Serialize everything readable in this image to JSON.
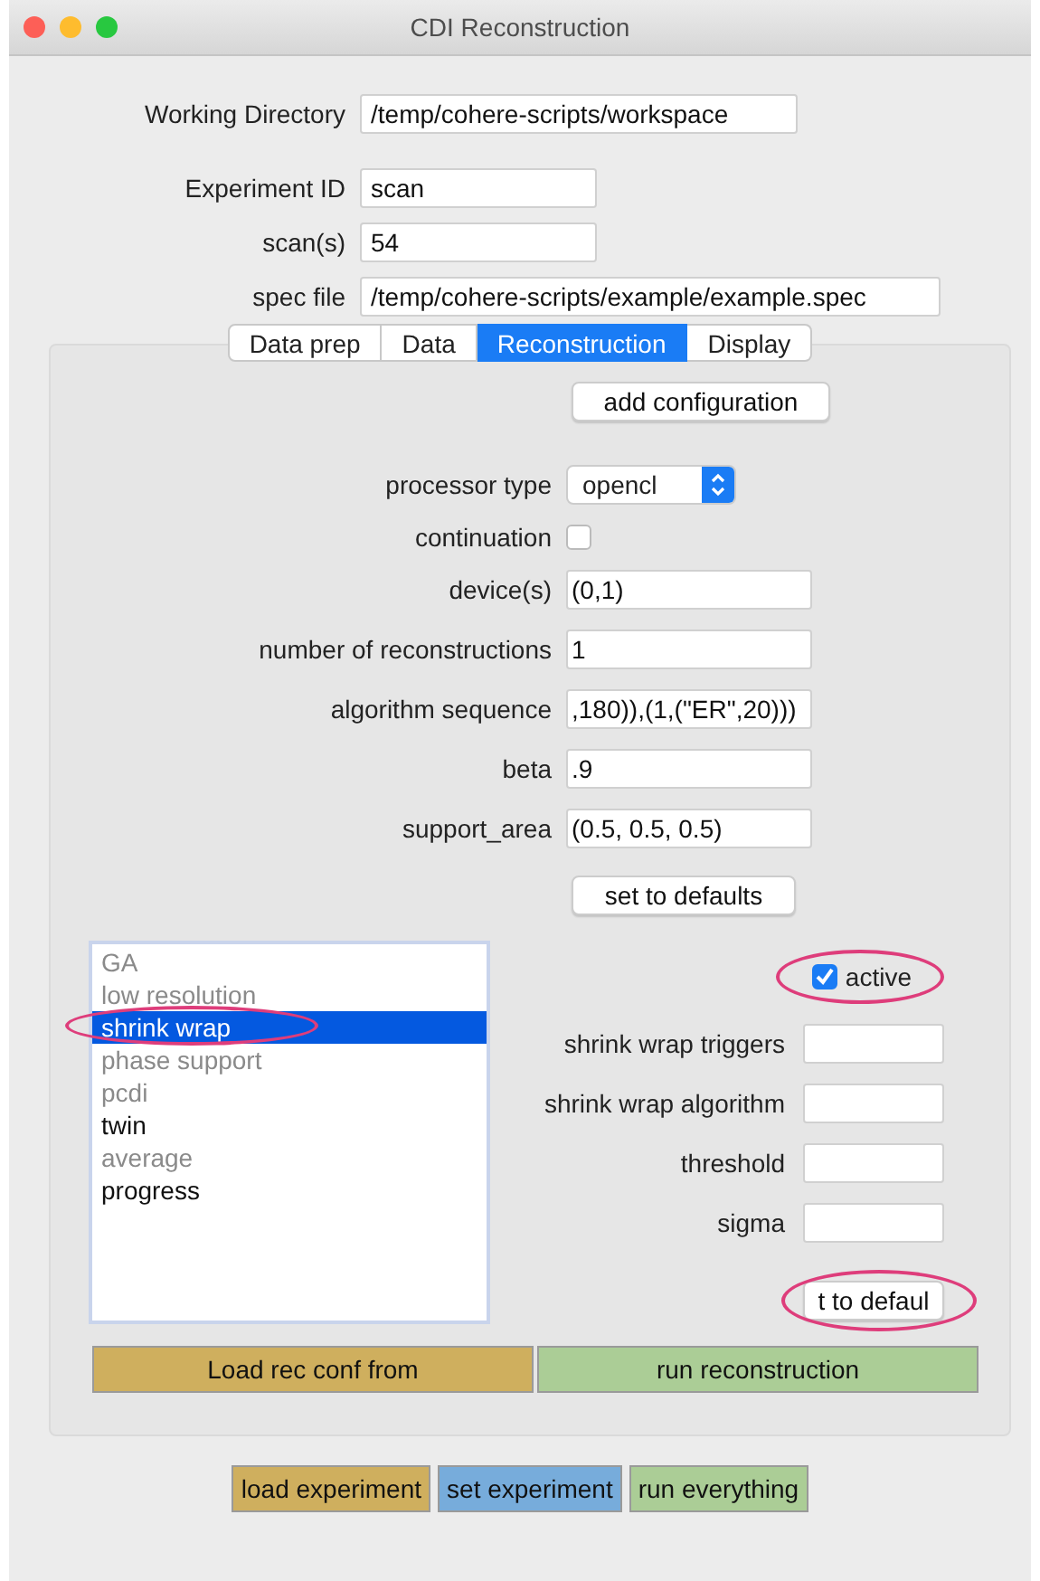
{
  "window": {
    "title": "CDI Reconstruction"
  },
  "header_fields": [
    {
      "label": "Working Directory",
      "value": "/temp/cohere-scripts/workspace"
    },
    {
      "label": "Experiment ID",
      "value": "scan"
    },
    {
      "label": "scan(s)",
      "value": "54"
    },
    {
      "label": "spec file",
      "value": "/temp/cohere-scripts/example/example.spec"
    }
  ],
  "tabs": [
    {
      "label": "Data prep",
      "selected": false
    },
    {
      "label": "Data",
      "selected": false
    },
    {
      "label": "Reconstruction",
      "selected": true
    },
    {
      "label": "Display",
      "selected": false
    }
  ],
  "add_button": "add configuration",
  "config_rows": [
    {
      "kind": "select",
      "label": "processor type",
      "value": "opencl"
    },
    {
      "kind": "checkbox",
      "label": "continuation",
      "checked": false
    },
    {
      "kind": "text",
      "label": "device(s)",
      "value": "(0,1)"
    },
    {
      "kind": "text",
      "label": "number of reconstructions",
      "value": "1"
    },
    {
      "kind": "text",
      "label": "algorithm sequence",
      "value": ",180)),(1,(\"ER\",20)))"
    },
    {
      "kind": "text",
      "label": "beta",
      "value": ".9"
    },
    {
      "kind": "text",
      "label": "support_area",
      "value": "(0.5, 0.5, 0.5)"
    }
  ],
  "defaults_button": "set to defaults",
  "feature_list": [
    {
      "label": "GA",
      "active": false,
      "selected": false,
      "circled": false
    },
    {
      "label": "low resolution",
      "active": false,
      "selected": false,
      "circled": false
    },
    {
      "label": "shrink wrap",
      "active": false,
      "selected": true,
      "circled": true
    },
    {
      "label": "phase support",
      "active": false,
      "selected": false,
      "circled": false
    },
    {
      "label": "pcdi",
      "active": false,
      "selected": false,
      "circled": false
    },
    {
      "label": "twin",
      "active": true,
      "selected": false,
      "circled": false
    },
    {
      "label": "average",
      "active": false,
      "selected": false,
      "circled": false
    },
    {
      "label": "progress",
      "active": true,
      "selected": false,
      "circled": false
    }
  ],
  "feature_panel": {
    "active": {
      "label": "active",
      "checked": true,
      "circled": true
    },
    "fields": [
      {
        "label": "shrink wrap triggers"
      },
      {
        "label": "shrink wrap algorithm"
      },
      {
        "label": "threshold"
      },
      {
        "label": "sigma"
      }
    ],
    "defaults_button": {
      "label": "t to defaul",
      "circled": true
    }
  },
  "action_buttons": [
    {
      "label": "Load rec conf from",
      "color": "#cfaf5e"
    },
    {
      "label": "run reconstruction",
      "color": "#abcd96"
    }
  ],
  "footer_buttons": [
    {
      "label": "load experiment",
      "color": "#cfaf5e"
    },
    {
      "label": "set experiment",
      "color": "#77acdb"
    },
    {
      "label": "run everything",
      "color": "#abcd96"
    }
  ]
}
